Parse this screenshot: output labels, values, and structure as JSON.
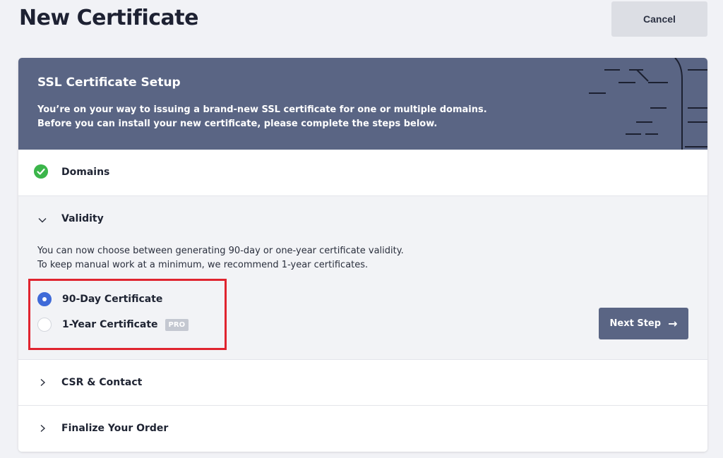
{
  "page": {
    "title": "New Certificate",
    "cancel_label": "Cancel"
  },
  "hero": {
    "title": "SSL Certificate Setup",
    "desc_line1": "You’re on your way to issuing a brand-new SSL certificate for one or multiple domains.",
    "desc_line2": "Before you can install your new certificate, please complete the steps below."
  },
  "steps": {
    "domains": {
      "label": "Domains",
      "status": "complete",
      "icon": "check-circle-icon"
    },
    "validity": {
      "label": "Validity",
      "expanded": true,
      "icon": "chevron-down-icon",
      "desc_line1": "You can now choose between generating 90-day or one-year certificate validity.",
      "desc_line2": "To keep manual work at a minimum, we recommend 1-year certificates.",
      "options": [
        {
          "label": "90-Day Certificate",
          "selected": true
        },
        {
          "label": "1-Year Certificate",
          "selected": false,
          "badge": "PRO"
        }
      ],
      "next_label": "Next Step",
      "next_icon": "arrow-right-icon"
    },
    "csr": {
      "label": "CSR & Contact",
      "icon": "chevron-right-icon"
    },
    "finalize": {
      "label": "Finalize Your Order",
      "icon": "chevron-right-icon"
    }
  },
  "colors": {
    "hero_bg": "#5a6584",
    "accent": "#3f6ad8",
    "success": "#3bb54a",
    "highlight": "#e0242f"
  }
}
